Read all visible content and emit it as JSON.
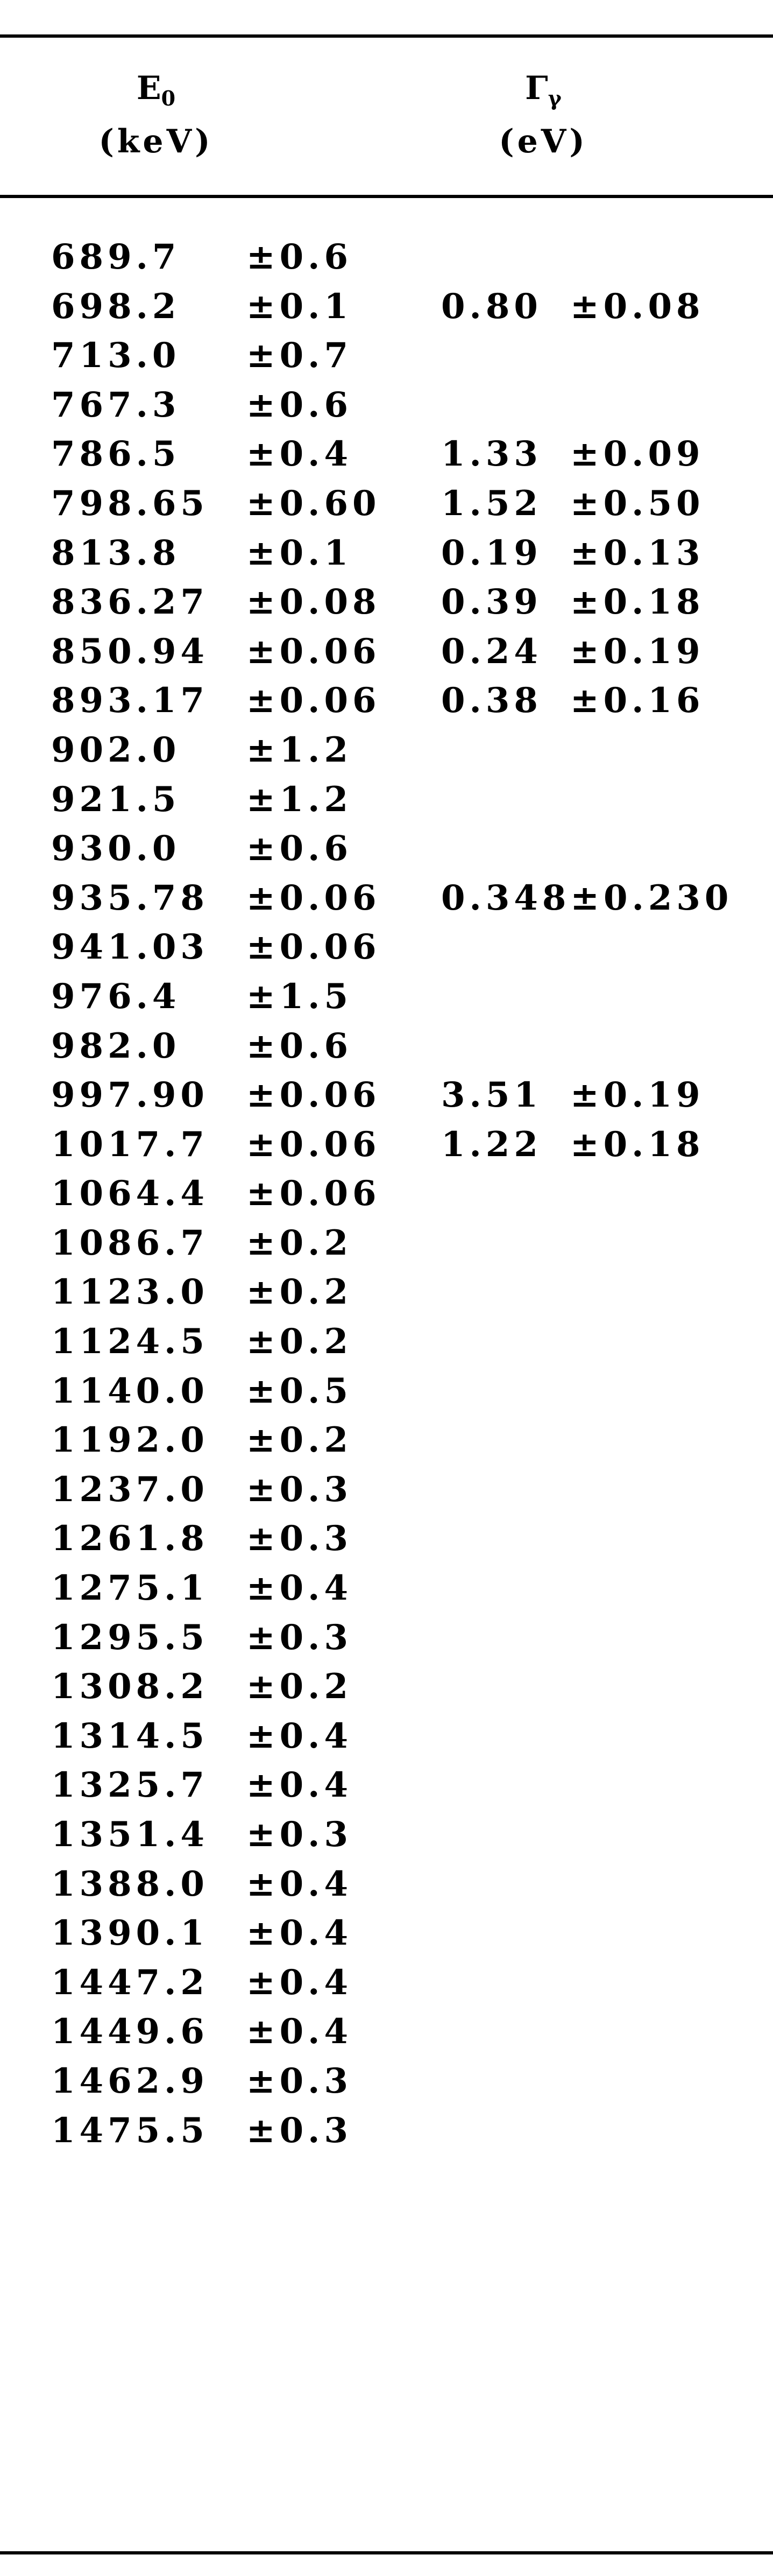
{
  "header": {
    "col1_symbol": "E",
    "col1_sub": "0",
    "col1_unit": "(keV)",
    "col2_symbol": "Γ",
    "col2_sub": "γ",
    "col2_unit": "(eV)"
  },
  "rows": [
    {
      "e": "689.7",
      "e_err": "±0.6",
      "g": "",
      "g_err": ""
    },
    {
      "e": "698.2",
      "e_err": "±0.1",
      "g": "0.80",
      "g_err": "±0.08"
    },
    {
      "e": "713.0",
      "e_err": "±0.7",
      "g": "",
      "g_err": ""
    },
    {
      "e": "767.3",
      "e_err": "±0.6",
      "g": "",
      "g_err": ""
    },
    {
      "e": "786.5",
      "e_err": "±0.4",
      "g": "1.33",
      "g_err": "±0.09"
    },
    {
      "e": "798.65",
      "e_err": "±0.60",
      "g": "1.52",
      "g_err": "±0.50"
    },
    {
      "e": "813.8",
      "e_err": "±0.1",
      "g": "0.19",
      "g_err": "±0.13"
    },
    {
      "e": "836.27",
      "e_err": "±0.08",
      "g": "0.39",
      "g_err": "±0.18"
    },
    {
      "e": "850.94",
      "e_err": "±0.06",
      "g": "0.24",
      "g_err": "±0.19"
    },
    {
      "e": "893.17",
      "e_err": "±0.06",
      "g": "0.38",
      "g_err": "±0.16"
    },
    {
      "e": "902.0",
      "e_err": "±1.2",
      "g": "",
      "g_err": ""
    },
    {
      "e": "921.5",
      "e_err": "±1.2",
      "g": "",
      "g_err": ""
    },
    {
      "e": "930.0",
      "e_err": "±0.6",
      "g": "",
      "g_err": ""
    },
    {
      "e": "935.78",
      "e_err": "±0.06",
      "g": "0.348±0.230",
      "g_err": ""
    },
    {
      "e": "941.03",
      "e_err": "±0.06",
      "g": "",
      "g_err": ""
    },
    {
      "e": "976.4",
      "e_err": "±1.5",
      "g": "",
      "g_err": ""
    },
    {
      "e": "982.0",
      "e_err": "±0.6",
      "g": "",
      "g_err": ""
    },
    {
      "e": "997.90",
      "e_err": "±0.06",
      "g": "3.51",
      "g_err": "±0.19"
    },
    {
      "e": "1017.7",
      "e_err": "±0.06",
      "g": "1.22",
      "g_err": "±0.18"
    },
    {
      "e": "1064.4",
      "e_err": "±0.06",
      "g": "",
      "g_err": ""
    },
    {
      "e": "1086.7",
      "e_err": "±0.2",
      "g": "",
      "g_err": ""
    },
    {
      "e": "1123.0",
      "e_err": "±0.2",
      "g": "",
      "g_err": ""
    },
    {
      "e": "1124.5",
      "e_err": "±0.2",
      "g": "",
      "g_err": ""
    },
    {
      "e": "1140.0",
      "e_err": "±0.5",
      "g": "",
      "g_err": ""
    },
    {
      "e": "1192.0",
      "e_err": "±0.2",
      "g": "",
      "g_err": ""
    },
    {
      "e": "1237.0",
      "e_err": "±0.3",
      "g": "",
      "g_err": ""
    },
    {
      "e": "1261.8",
      "e_err": "±0.3",
      "g": "",
      "g_err": ""
    },
    {
      "e": "1275.1",
      "e_err": "±0.4",
      "g": "",
      "g_err": ""
    },
    {
      "e": "1295.5",
      "e_err": "±0.3",
      "g": "",
      "g_err": ""
    },
    {
      "e": "1308.2",
      "e_err": "±0.2",
      "g": "",
      "g_err": ""
    },
    {
      "e": "1314.5",
      "e_err": "±0.4",
      "g": "",
      "g_err": ""
    },
    {
      "e": "1325.7",
      "e_err": "±0.4",
      "g": "",
      "g_err": ""
    },
    {
      "e": "1351.4",
      "e_err": "±0.3",
      "g": "",
      "g_err": ""
    },
    {
      "e": "1388.0",
      "e_err": "±0.4",
      "g": "",
      "g_err": ""
    },
    {
      "e": "1390.1",
      "e_err": "±0.4",
      "g": "",
      "g_err": ""
    },
    {
      "e": "1447.2",
      "e_err": "±0.4",
      "g": "",
      "g_err": ""
    },
    {
      "e": "1449.6",
      "e_err": "±0.4",
      "g": "",
      "g_err": ""
    },
    {
      "e": "1462.9",
      "e_err": "±0.3",
      "g": "",
      "g_err": ""
    },
    {
      "e": "1475.5",
      "e_err": "±0.3",
      "g": "",
      "g_err": ""
    }
  ]
}
